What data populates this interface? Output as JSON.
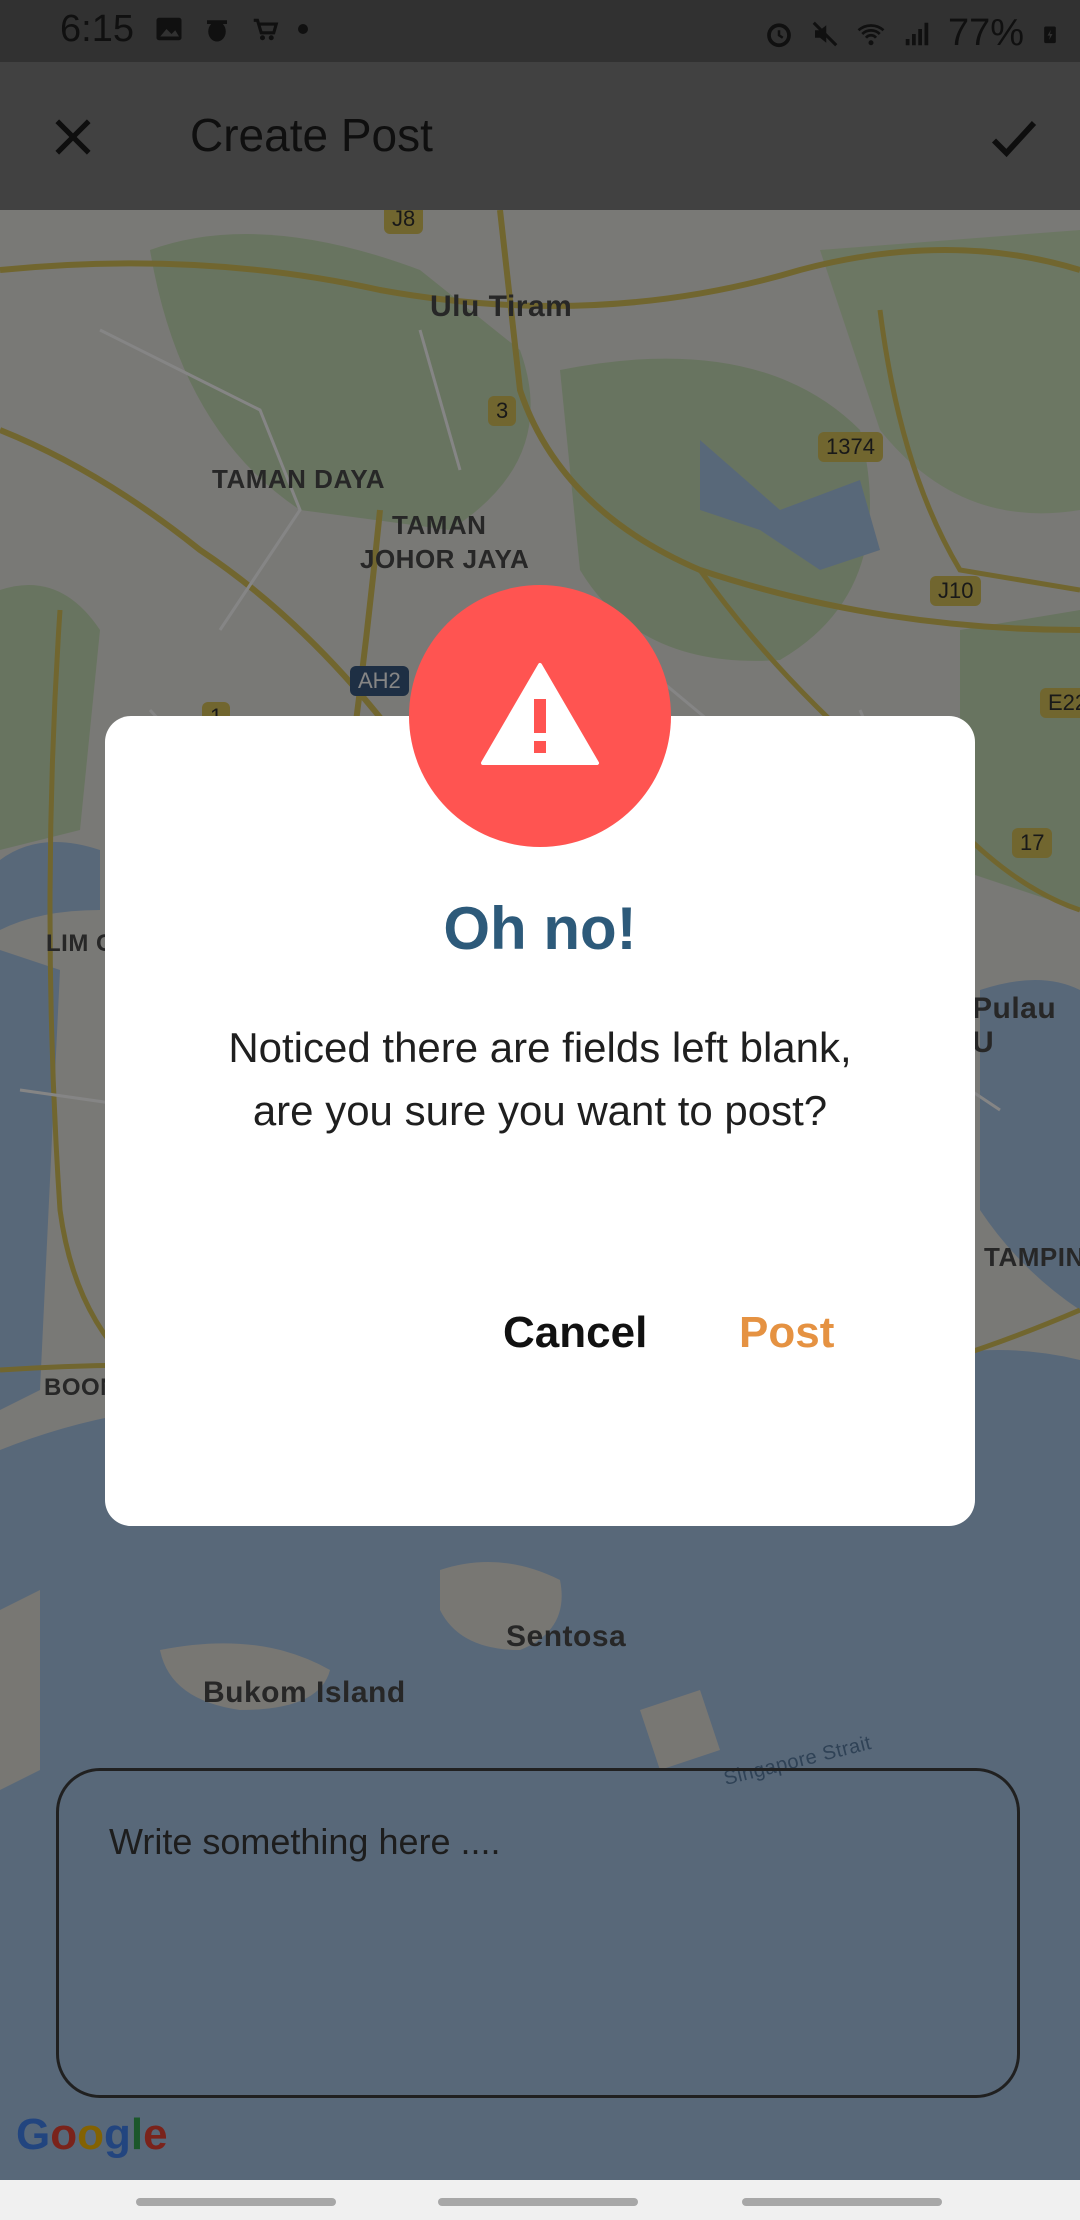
{
  "status_bar": {
    "time": "6:15",
    "battery": "77%",
    "icons": [
      "image-icon",
      "bug-icon",
      "cart-icon",
      "dot-icon",
      "alarm-icon",
      "mute-icon",
      "wifi-icon",
      "signal-icon",
      "battery-charging-icon"
    ]
  },
  "app_bar": {
    "title": "Create Post",
    "close_icon": "close-icon",
    "confirm_icon": "check-icon"
  },
  "map": {
    "labels": [
      "Ulu Tiram",
      "TAMAN DAYA",
      "TAMAN",
      "JOHOR JAYA",
      "LIM C",
      "Pulau U",
      "TAMPIN",
      "BOON",
      "Sentosa",
      "Bukom Island",
      "Singapore Strait"
    ],
    "shields": [
      "J8",
      "3",
      "1374",
      "J10",
      "AH2",
      "1",
      "E22",
      "17"
    ],
    "attribution": "Google"
  },
  "post_input": {
    "placeholder": "Write something here ...."
  },
  "dialog": {
    "icon": "warning-icon",
    "accent_color": "#ff5451",
    "heading": "Oh no!",
    "message": "Noticed there are fields left blank, are you sure you want to post?",
    "cancel_label": "Cancel",
    "post_label": "Post",
    "post_color": "#e59242"
  }
}
